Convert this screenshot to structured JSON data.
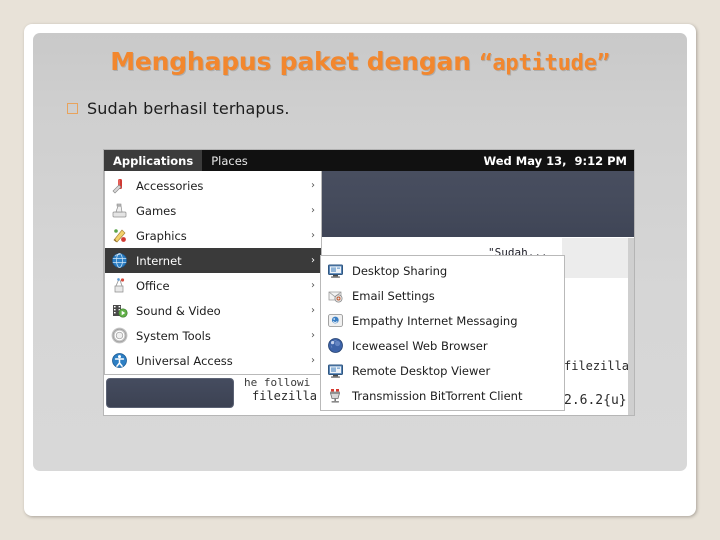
{
  "slide": {
    "title_main": "Menghapus paket dengan ",
    "title_quoted": "“aptitude”",
    "bullet": "Sudah berhasil terhapus."
  },
  "screenshot": {
    "panel": {
      "applications_label": "Applications",
      "places_label": "Places",
      "clock": "Wed May 13,  9:12 PM"
    },
    "applications_menu": [
      {
        "label": "Accessories",
        "icon": "accessories-icon",
        "arrow": "›",
        "selected": false
      },
      {
        "label": "Games",
        "icon": "games-icon",
        "arrow": "›",
        "selected": false
      },
      {
        "label": "Graphics",
        "icon": "graphics-icon",
        "arrow": "›",
        "selected": false
      },
      {
        "label": "Internet",
        "icon": "internet-globe-icon",
        "arrow": "›",
        "selected": true
      },
      {
        "label": "Office",
        "icon": "office-icon",
        "arrow": "›",
        "selected": false
      },
      {
        "label": "Sound & Video",
        "icon": "sound-video-icon",
        "arrow": "›",
        "selected": false
      },
      {
        "label": "System Tools",
        "icon": "system-tools-icon",
        "arrow": "›",
        "selected": false
      },
      {
        "label": "Universal Access",
        "icon": "universal-access-icon",
        "arrow": "›",
        "selected": false
      }
    ],
    "internet_submenu": [
      {
        "label": "Desktop Sharing",
        "icon": "desktop-sharing-icon"
      },
      {
        "label": "Email Settings",
        "icon": "email-settings-icon"
      },
      {
        "label": "Empathy Internet Messaging",
        "icon": "empathy-icon"
      },
      {
        "label": "Iceweasel Web Browser",
        "icon": "iceweasel-icon"
      },
      {
        "label": "Remote Desktop Viewer",
        "icon": "remote-desktop-icon"
      },
      {
        "label": "Transmission BitTorrent Client",
        "icon": "transmission-icon"
      }
    ],
    "background_terminal": {
      "line_partial_1": "\"Sudah...",
      "line_partial_2": "he followi",
      "line_partial_3": "filezilla",
      "line_partial_4": "filezilla",
      "line_partial_5": "2.6.2{u}"
    }
  },
  "colors": {
    "slide_bg": "#e8e2d8",
    "panel_bg": "#d4d4d4",
    "title_orange": "#f2872e",
    "bullet_orange": "#e8a35c",
    "desktop_slate": "#454b5c",
    "menu_selected": "#3a3a3a"
  }
}
